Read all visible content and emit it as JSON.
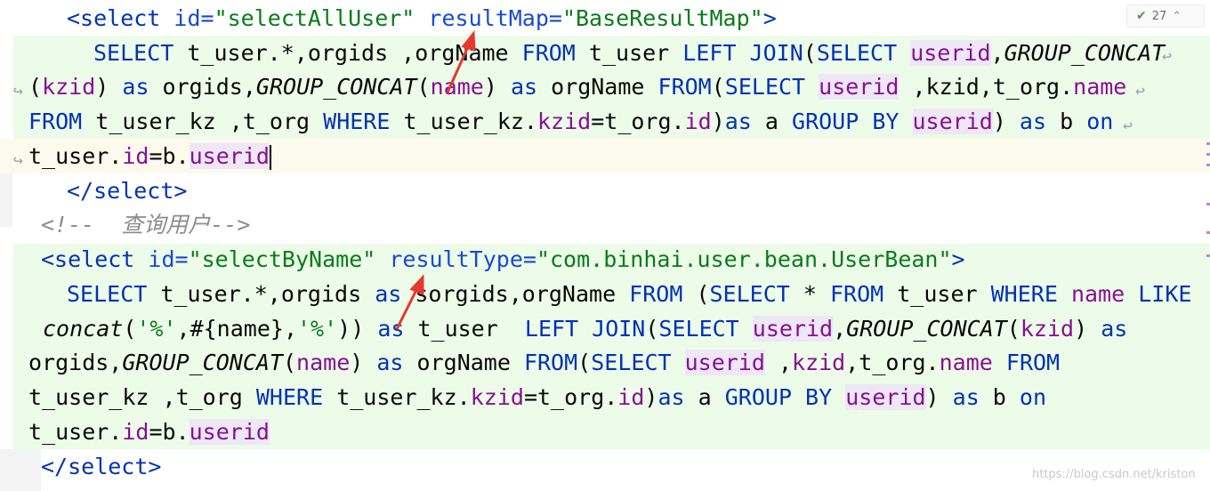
{
  "editor": {
    "line1": {
      "open": "<select",
      "id_attr": "id=",
      "id_val": "\"selectAllUser\"",
      "rm_attr": "resultMap=",
      "rm_val": "\"BaseResultMap\"",
      "close": ">"
    },
    "line2": {
      "t1": "SELECT",
      "t2": " t_user.*,orgids ,orgName ",
      "t3": "FROM",
      "t4": " t_user ",
      "t5": "LEFT JOIN",
      "t6": "(",
      "t7": "SELECT",
      "t8": " ",
      "t9": "userid",
      "t10": ",",
      "t11": "GROUP_CONCAT"
    },
    "line3": {
      "t1": "(",
      "t2": "kzid",
      "t3": ") ",
      "t4": "as",
      "t5": " orgids,",
      "t6": "GROUP_CONCAT",
      "t7": "(",
      "t8": "name",
      "t9": ") ",
      "t10": "as",
      "t11": " orgName ",
      "t12": "FROM",
      "t13": "(",
      "t14": "SELECT",
      "t15": " ",
      "t16": "userid",
      "t17": " ,kzid,t_org.",
      "t18": "name"
    },
    "line4": {
      "t1": "FROM",
      "t2": " t_user_kz ,t_org ",
      "t3": "WHERE",
      "t4": " t_user_kz.",
      "t5": "kzid",
      "t6": "=t_org.",
      "t7": "id",
      "t8": ")",
      "t9": "as",
      "t10": " a ",
      "t11": "GROUP BY",
      "t12": " ",
      "t13": "userid",
      "t14": ") ",
      "t15": "as",
      "t16": " b ",
      "t17": "on"
    },
    "line5": {
      "t1": "t_user.",
      "t2": "id",
      "t3": "=b.",
      "t4": "userid"
    },
    "line6": {
      "t1": "</select>"
    },
    "line7": {
      "t1": "<!--  查询用户-->"
    },
    "line8": {
      "open": "<select",
      "id_attr": "id=",
      "id_val": "\"selectByName\"",
      "rt_attr": "resultType=",
      "rt_val": "\"com.binhai.user.bean.UserBean\"",
      "close": ">"
    },
    "line9": {
      "t1": "SELECT",
      "t2": " t_user.*,orgids ",
      "t3": "as",
      "t4": " sorgids,orgName ",
      "t5": "FROM",
      "t6": " (",
      "t7": "SELECT",
      "t8": " * ",
      "t9": "FROM",
      "t10": " t_user ",
      "t11": "WHERE",
      "t12": " ",
      "t13": "name",
      "t14": " ",
      "t15": "LIKE"
    },
    "line10": {
      "t1": "concat",
      "t2": "(",
      "t3": "'%'",
      "t4": ",#{name},",
      "t5": "'%'",
      "t6": ")) ",
      "t7": "as",
      "t8": " t_user  ",
      "t9": "LEFT JOIN",
      "t10": "(",
      "t11": "SELECT",
      "t12": " ",
      "t13": "userid",
      "t14": ",",
      "t15": "GROUP_CONCAT",
      "t16": "(",
      "t17": "kzid",
      "t18": ") ",
      "t19": "as"
    },
    "line11": {
      "t1": "orgids,",
      "t2": "GROUP_CONCAT",
      "t3": "(",
      "t4": "name",
      "t5": ") ",
      "t6": "as",
      "t7": " orgName ",
      "t8": "FROM",
      "t9": "(",
      "t10": "SELECT",
      "t11": " ",
      "t12": "userid",
      "t13": " ,",
      "t14": "kzid",
      "t15": ",t_org.",
      "t16": "name",
      "t17": " ",
      "t18": "FROM"
    },
    "line12": {
      "t1": "t_user_kz ,t_org ",
      "t2": "WHERE",
      "t3": " t_user_kz.",
      "t4": "kzid",
      "t5": "=t_org.",
      "t6": "id",
      "t7": ")",
      "t8": "as",
      "t9": " a ",
      "t10": "GROUP BY",
      "t11": " ",
      "t12": "userid",
      "t13": ") ",
      "t14": "as",
      "t15": " b ",
      "t16": "on"
    },
    "line13": {
      "t1": "t_user.",
      "t2": "id",
      "t3": "=b.",
      "t4": "userid"
    },
    "line14": {
      "t1": "</select>"
    }
  },
  "inspection": {
    "count": "27",
    "icon": "double-check-icon"
  },
  "watermark": "https://blog.csdn.net/kriston",
  "colors": {
    "highlight_block": "#edfbe9",
    "current_line": "#fcfaed",
    "keyword": "#0033b3",
    "string": "#067d17",
    "column": "#871094",
    "comment": "#8c8c8c",
    "arrow": "#e8382e"
  }
}
